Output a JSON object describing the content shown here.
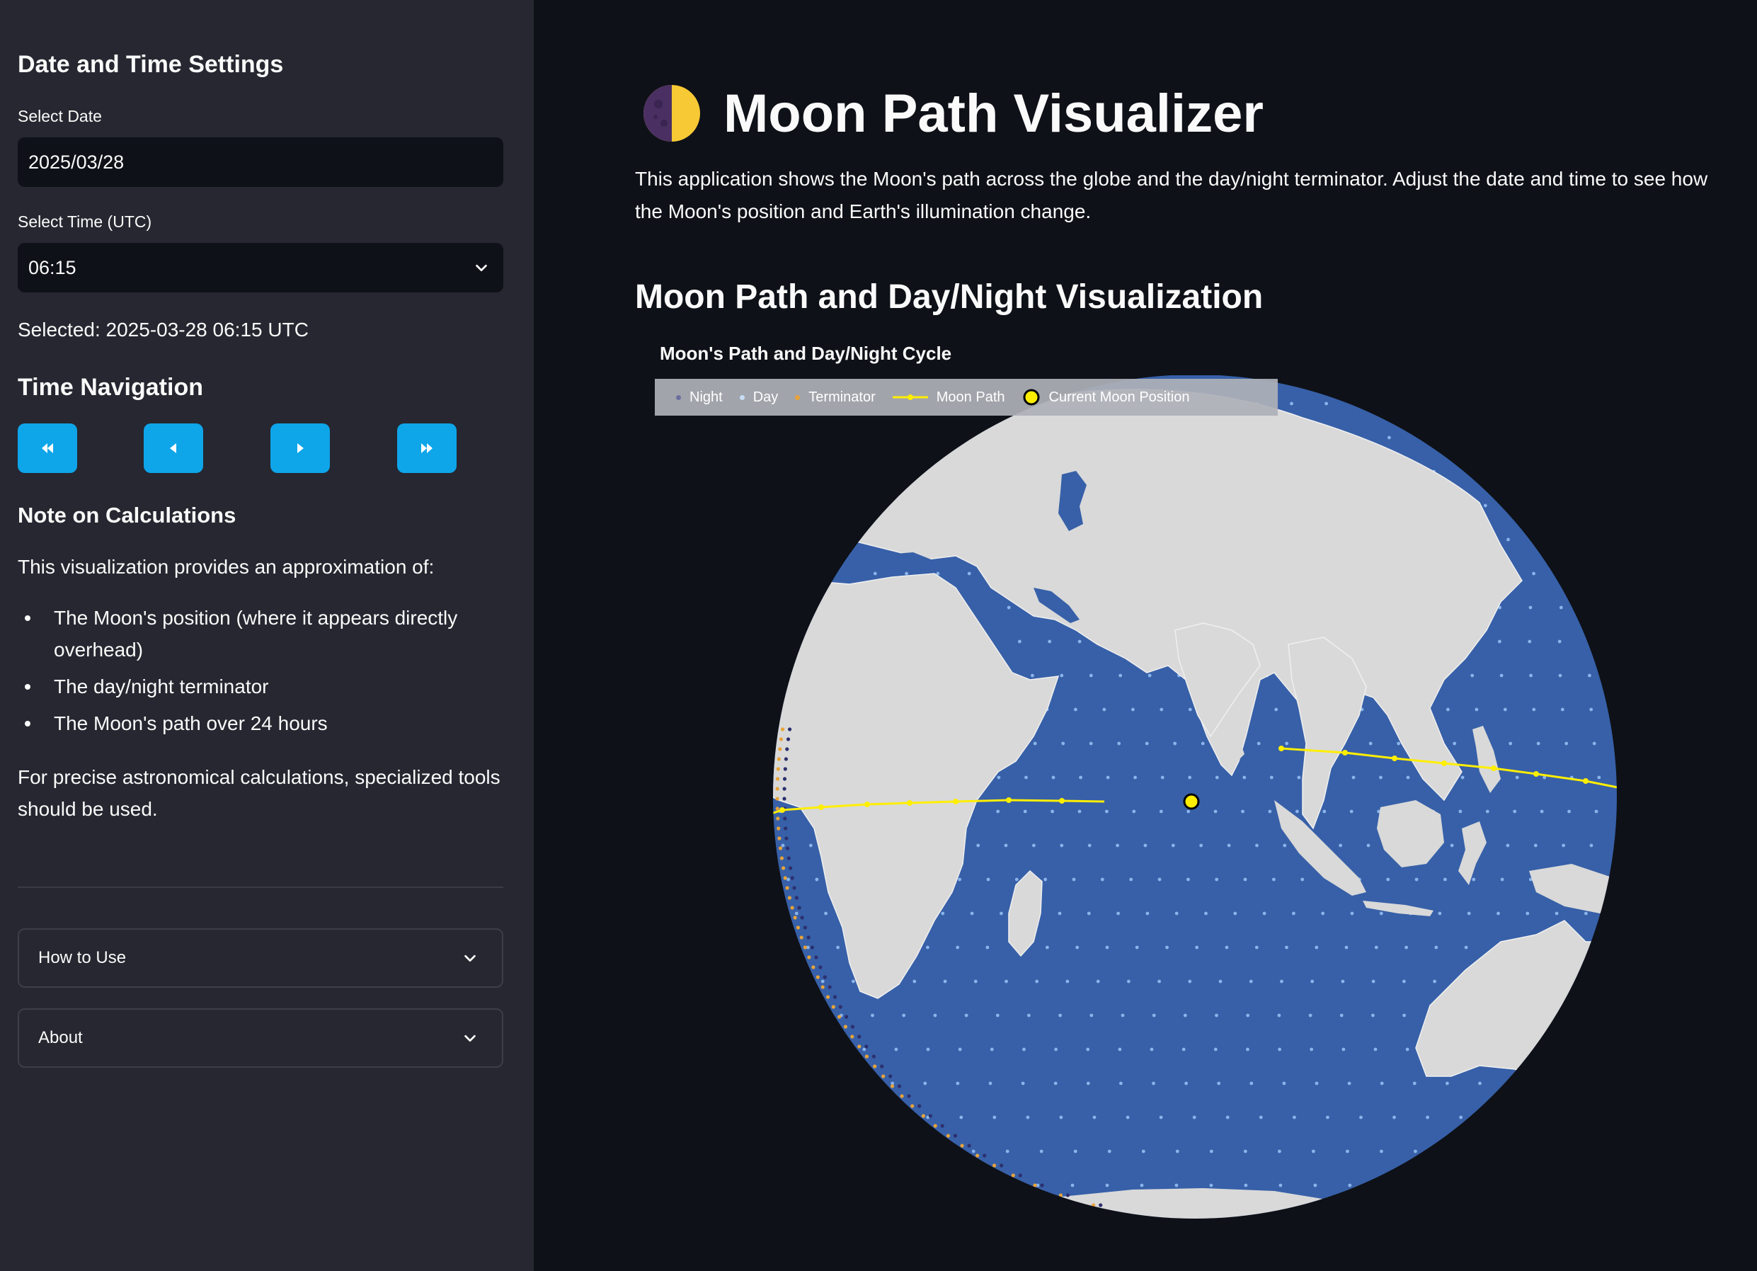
{
  "sidebar": {
    "date_time_heading": "Date and Time Settings",
    "date_label": "Select Date",
    "date_value": "2025/03/28",
    "time_label": "Select Time (UTC)",
    "time_value": "06:15",
    "selected_text": "Selected: 2025-03-28 06:15 UTC",
    "time_nav_heading": "Time Navigation",
    "nav_buttons": [
      "rewind-fast-icon",
      "step-back-icon",
      "step-forward-icon",
      "forward-fast-icon"
    ],
    "note_heading": "Note on Calculations",
    "note_intro": "This visualization provides an approximation of:",
    "note_items": [
      "The Moon's position (where it appears directly overhead)",
      "The day/night terminator",
      "The Moon's path over 24 hours"
    ],
    "note_footer": "For precise astronomical calculations, specialized tools should be used.",
    "expanders": [
      "How to Use",
      "About"
    ]
  },
  "main": {
    "title_icon": "moon-icon",
    "title": "Moon Path Visualizer",
    "intro": "This application shows the Moon's path across the globe and the day/night terminator. Adjust the date and time to see how the Moon's position and Earth's illumination change.",
    "section_heading": "Moon Path and Day/Night Visualization"
  },
  "chart": {
    "title": "Moon's Path and Day/Night Cycle",
    "legend": [
      {
        "label": "Night",
        "color": "#3a3f7a"
      },
      {
        "label": "Day",
        "color": "#9fc5ee"
      },
      {
        "label": "Terminator",
        "color": "#e8a33a"
      },
      {
        "label": "Moon Path",
        "color": "#ffee00"
      },
      {
        "label": "Current Moon Position",
        "color": "#ffee00"
      }
    ]
  },
  "colors": {
    "accent": "#0ea5e9",
    "ocean": "#3760a8",
    "land": "#d9d9d9",
    "moon_path": "#ffee00"
  }
}
